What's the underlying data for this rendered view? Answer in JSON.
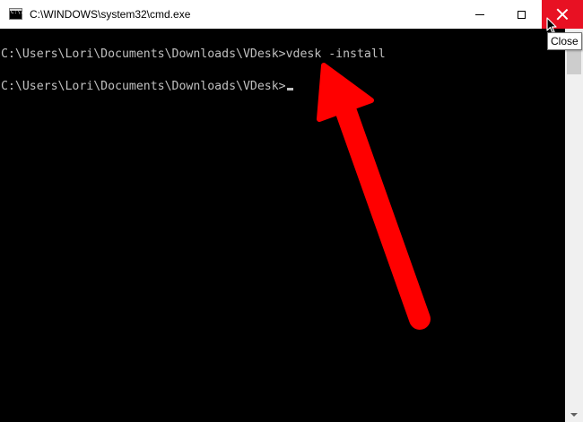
{
  "window": {
    "title": "C:\\WINDOWS\\system32\\cmd.exe",
    "icon": "cmd-icon",
    "icon_text": "C:\\."
  },
  "controls": {
    "minimize_icon": "minimize-icon",
    "maximize_icon": "maximize-icon",
    "close_icon": "close-icon",
    "close_color": "#e81123"
  },
  "tooltip": {
    "text": "Close"
  },
  "console": {
    "lines": [
      "C:\\Users\\Lori\\Documents\\Downloads\\VDesk>vdesk -install",
      "C:\\Users\\Lori\\Documents\\Downloads\\VDesk>"
    ],
    "text_color": "#c0c0c0",
    "background": "#000000"
  },
  "annotation": {
    "color": "#ff0000",
    "shape": "arrow"
  }
}
